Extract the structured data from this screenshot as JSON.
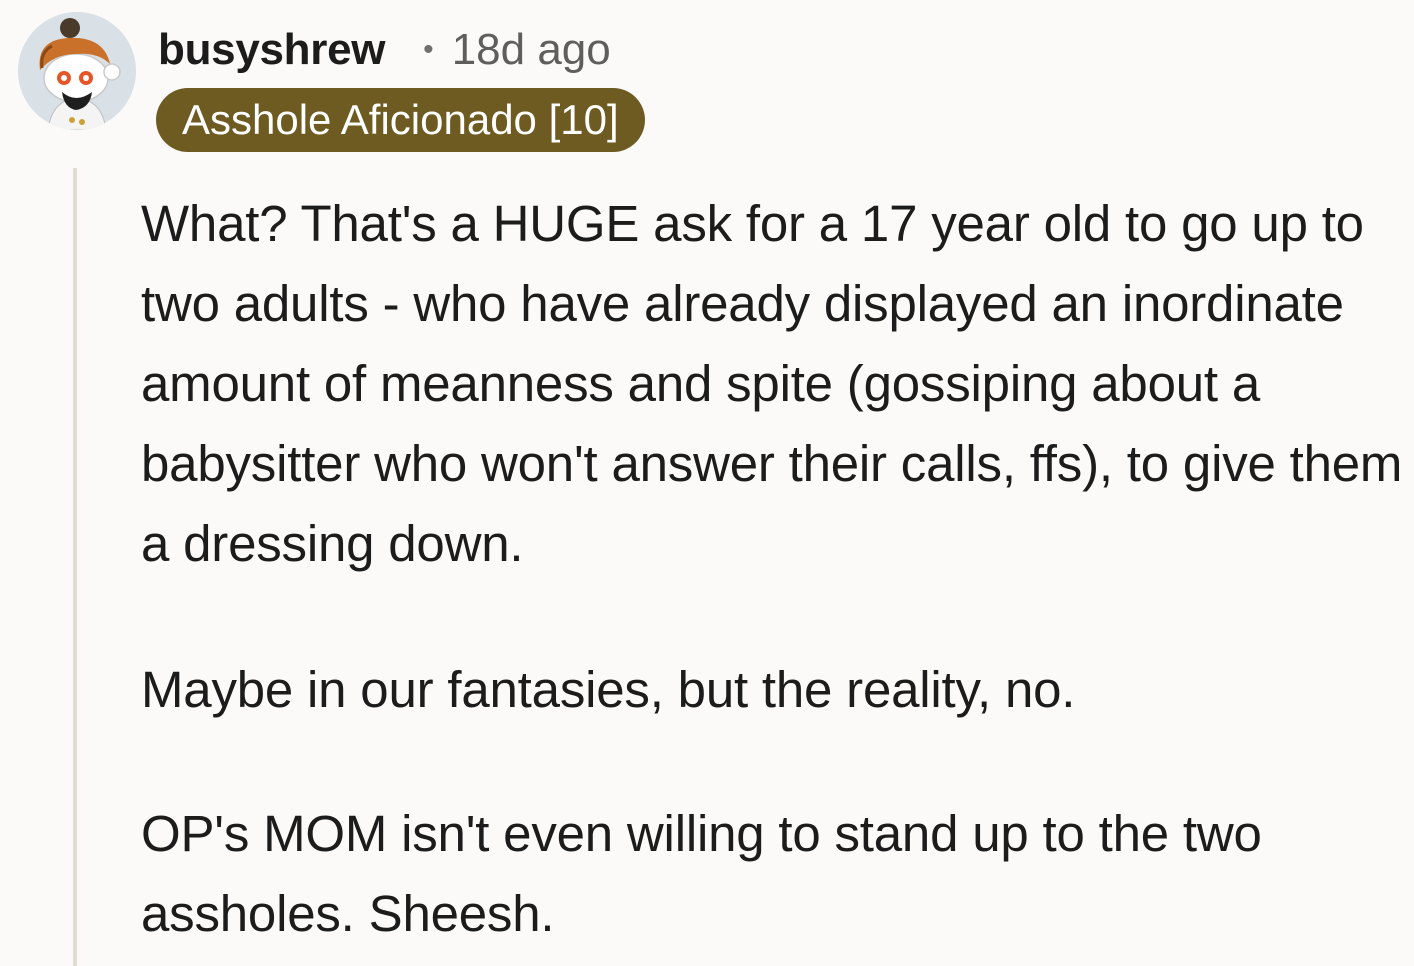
{
  "comment": {
    "username": "busyshrew",
    "separator": "•",
    "timestamp": "18d ago",
    "flair": "Asshole Aficionado [10]",
    "paragraphs": [
      "What? That's a HUGE ask for a 17 year old to go up to two adults - who have already displayed an inordinate amount of meanness and spite (gossiping about a babysitter who won't answer their calls, ffs), to give them a dressing down.",
      "Maybe in our fantasies, but the reality, no.",
      "OP's MOM isn't even willing to stand up to the two assholes. Sheesh."
    ]
  },
  "colors": {
    "background": "#fbfaf8",
    "flair_background": "#6e5b22",
    "thread_line": "#e3dcd3",
    "text": "#1c1c1c",
    "muted_text": "#5e5e5e"
  },
  "icons": {
    "avatar": "snoo-avatar-icon"
  }
}
